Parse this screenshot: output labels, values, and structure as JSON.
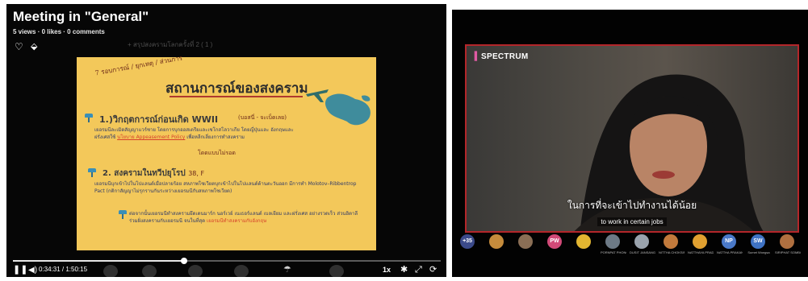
{
  "video_post": {
    "title": "Meeting in \"General\"",
    "meta": "5 views · 0 likes · 0 comments",
    "time_display": "0:34:31 / 1:50:15",
    "speed": "1x",
    "progress": 0.4
  },
  "slide": {
    "title": "สถานการณ์ของสงคราม",
    "heading1": "1.)วิกฤตการณ์ก่อนเกิด WWII",
    "heading2": "2. สงครามในทวีปยุโรป",
    "handwritten_note": "(บอสนี่ - จะเบ็ดเลย)",
    "handwritten_note2": "โดดแบบไม่รอด",
    "handwritten_note3": "7 รอบการณ์ / ยุกเหตุ / ส่วนการ",
    "heading2_note": "38, F",
    "para1_a": "เยอรมนีละเมิดสัญญาแวร์ซาย โดยการบุกออสเตรียและเชโกสโลวาเกีย โดยญี่ปุ่นและ",
    "para1_b": "อังกฤษและฝรั่งเศสใช้",
    "para1_hl": "นโยบาย Appeasement Policy",
    "para1_c": "เพื่อหลีกเลี่ยงการทำสงคราม",
    "para2": "เยอรมนีบุกเข้าไปในโปแลนด์เมื่อปลายร้อย สหภาพโซเวียตบุกเข้าไปในโปแลนด์ด้านตะวันออก มีการทำ Molotov–Ribbentrop Pact (กติกาสัญญาไม่รุกรานกันระหว่างเยอรมนีกับสหภาพโซเวียต)",
    "para3_a": "ต่อจากนั้นเยอรมนีทำสงครามยึดเดนมาร์ก นอร์เวย์ เนเธอร์แลนด์ เบลเยียม และฝรั่งเศส อย่างรวดเร็ว ส่วนอิตาลีร่วมฝั่งสงครามกับเยอรมนี จนในที่สุด",
    "para3_hl": "เยอรมนีทำสงครามกับอังกฤษ",
    "hud_title": "+ สรุปสงครามโลกครั้งที่ 2 ( 1 )"
  },
  "meeting": {
    "brand": "SPECTRUM",
    "subtitle_th": "ในการที่จะเข้าไปทำงานได้น้อย",
    "subtitle_en": "to work in certain jobs",
    "participants": [
      {
        "initials": "+35",
        "color": "#3b4a8a",
        "name": ""
      },
      {
        "initials": "",
        "color": "#c58b3c",
        "name": ""
      },
      {
        "initials": "",
        "color": "#8a6e55",
        "name": ""
      },
      {
        "initials": "PW",
        "color": "#d24a78",
        "name": ""
      },
      {
        "initials": "",
        "color": "#e3b631",
        "name": ""
      },
      {
        "initials": "",
        "color": "#6d7a86",
        "name": "PORNPAT PHONGPHAN"
      },
      {
        "initials": "",
        "color": "#9aa3ad",
        "name": "DUSIT JANSANG"
      },
      {
        "initials": "",
        "color": "#c27a3c",
        "name": "NITTHA CHOKSIRI"
      },
      {
        "initials": "",
        "color": "#e0a030",
        "name": "NATTHAYA PRADIT"
      },
      {
        "initials": "NP",
        "color": "#4a79c8",
        "name": "NATTHA PRAKAN"
      },
      {
        "initials": "SW",
        "color": "#3f73c4",
        "name": "Sumet Wongsa"
      },
      {
        "initials": "",
        "color": "#b07040",
        "name": "SIRIPHAT SOMBOON"
      }
    ]
  },
  "colors": {
    "slide_bg": "#f3c85a",
    "active_border": "#b3262a",
    "accent_text": "#d6402b"
  }
}
